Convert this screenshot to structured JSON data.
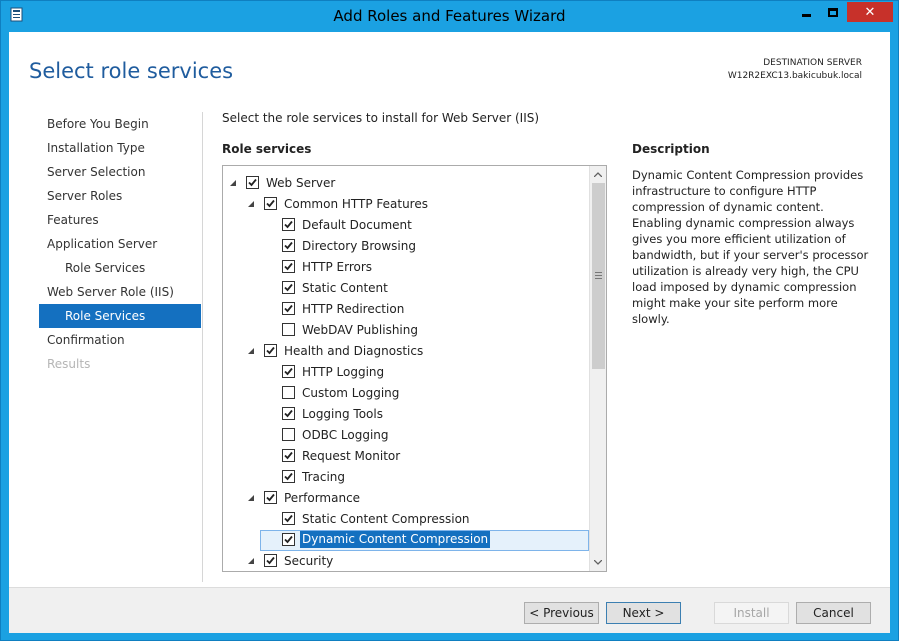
{
  "window": {
    "title": "Add Roles and Features Wizard",
    "controls": [
      "minimize-icon",
      "maximize-icon",
      "close-icon"
    ],
    "accent_color": "#1ba1e2",
    "close_color": "#c7312a"
  },
  "header": {
    "page_title": "Select role services",
    "destination_label": "DESTINATION SERVER",
    "destination_server": "W12R2EXC13.bakicubuk.local"
  },
  "nav": {
    "items": [
      {
        "label": "Before You Begin",
        "state": "normal"
      },
      {
        "label": "Installation Type",
        "state": "normal"
      },
      {
        "label": "Server Selection",
        "state": "normal"
      },
      {
        "label": "Server Roles",
        "state": "normal"
      },
      {
        "label": "Features",
        "state": "normal"
      },
      {
        "label": "Application Server",
        "state": "normal"
      },
      {
        "label": "Role Services",
        "state": "normal"
      },
      {
        "label": "Web Server Role (IIS)",
        "state": "normal"
      },
      {
        "label": "Role Services",
        "state": "active"
      },
      {
        "label": "Confirmation",
        "state": "normal"
      },
      {
        "label": "Results",
        "state": "disabled"
      }
    ]
  },
  "main": {
    "instruction": "Select the role services to install for Web Server (IIS)",
    "role_services_label": "Role services",
    "tree": [
      {
        "label": "Web Server",
        "level": 0,
        "expanded": true,
        "checked": true
      },
      {
        "label": "Common HTTP Features",
        "level": 1,
        "expanded": true,
        "checked": true
      },
      {
        "label": "Default Document",
        "level": 2,
        "checked": true
      },
      {
        "label": "Directory Browsing",
        "level": 2,
        "checked": true
      },
      {
        "label": "HTTP Errors",
        "level": 2,
        "checked": true
      },
      {
        "label": "Static Content",
        "level": 2,
        "checked": true
      },
      {
        "label": "HTTP Redirection",
        "level": 2,
        "checked": true
      },
      {
        "label": "WebDAV Publishing",
        "level": 2,
        "checked": false
      },
      {
        "label": "Health and Diagnostics",
        "level": 1,
        "expanded": true,
        "checked": true
      },
      {
        "label": "HTTP Logging",
        "level": 2,
        "checked": true
      },
      {
        "label": "Custom Logging",
        "level": 2,
        "checked": false
      },
      {
        "label": "Logging Tools",
        "level": 2,
        "checked": true
      },
      {
        "label": "ODBC Logging",
        "level": 2,
        "checked": false
      },
      {
        "label": "Request Monitor",
        "level": 2,
        "checked": true
      },
      {
        "label": "Tracing",
        "level": 2,
        "checked": true
      },
      {
        "label": "Performance",
        "level": 1,
        "expanded": true,
        "checked": true
      },
      {
        "label": "Static Content Compression",
        "level": 2,
        "checked": true
      },
      {
        "label": "Dynamic Content Compression",
        "level": 2,
        "checked": true,
        "selected": true
      },
      {
        "label": "Security",
        "level": 1,
        "expanded": true,
        "checked": true
      }
    ],
    "description_label": "Description",
    "description_text": "Dynamic Content Compression provides infrastructure to configure HTTP compression of dynamic content. Enabling dynamic compression always gives you more efficient utilization of bandwidth, but if your server's processor utilization is already very high, the CPU load imposed by dynamic compression might make your site perform more slowly."
  },
  "footer": {
    "previous_label": "< Previous",
    "next_label": "Next >",
    "install_label": "Install",
    "cancel_label": "Cancel"
  }
}
